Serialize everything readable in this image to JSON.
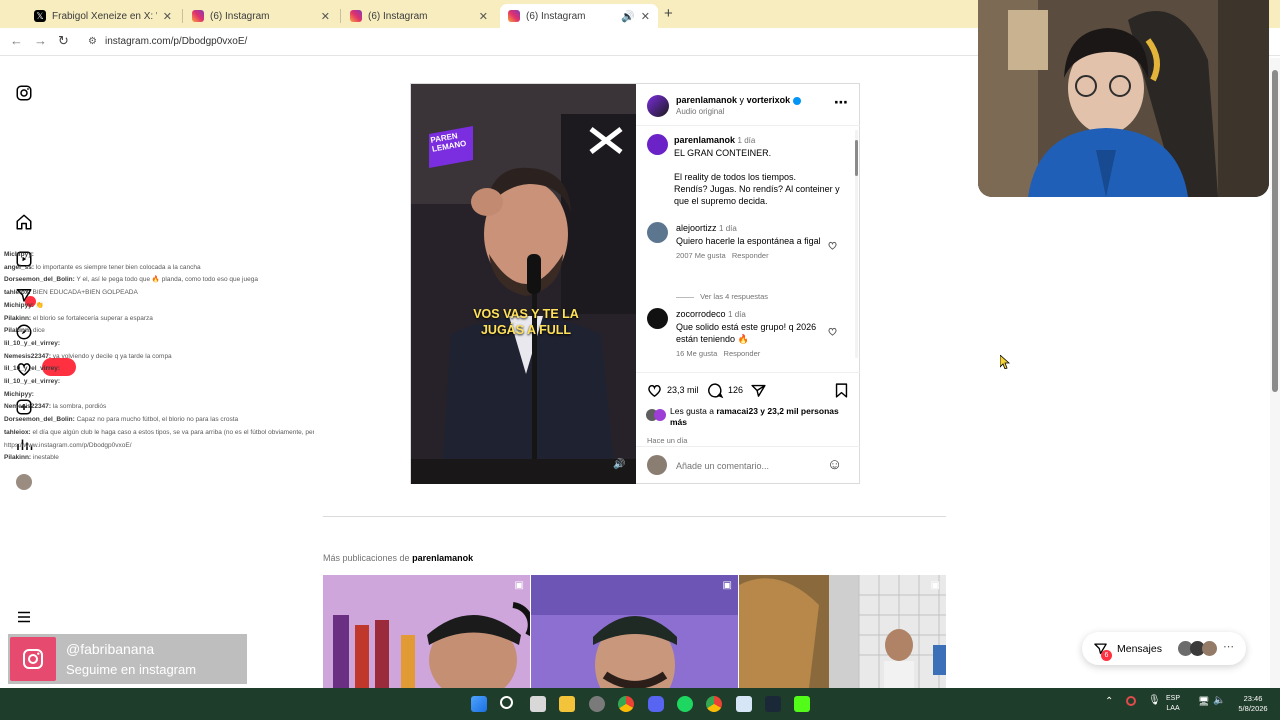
{
  "browser": {
    "tabs": [
      {
        "title": "Frabigol Xeneize en X: \"Y si jug",
        "favicon": "x-logo-icon"
      },
      {
        "title": "(6) Instagram",
        "favicon": "instagram-icon"
      },
      {
        "title": "(6) Instagram",
        "favicon": "instagram-icon"
      },
      {
        "title": "(6) Instagram",
        "favicon": "instagram-icon",
        "active": true
      }
    ],
    "new_tab": "+",
    "url": "instagram.com/p/Dbodgp0vxoE/"
  },
  "chat": [
    {
      "user": "Michipyy:",
      "msg": ""
    },
    {
      "user": "angel_ss:",
      "msg": "lo importante es siempre tener bien colocada a la cancha"
    },
    {
      "user": "Dorseemon_del_Bolin:",
      "msg": "Y el, así le pega todo que 🔥 planda, como todo eso que juega"
    },
    {
      "user": "tahleiox:",
      "msg": "BIEN EDUCADA+BIEN GOLPEADA"
    },
    {
      "user": "Michipyy:",
      "msg": "👏"
    },
    {
      "user": "Pilakinn:",
      "msg": "el blorio se fortalecería superar a esparza"
    },
    {
      "user": "Pilakinn:",
      "msg": "dice"
    },
    {
      "user": "lil_10_y_el_virrey:",
      "msg": ""
    },
    {
      "user": "Nemesis22347:",
      "msg": "ya volviendo y decile q ya tarde la compa"
    },
    {
      "user": "lil_10_y_el_virrey:",
      "msg": ""
    },
    {
      "user": "lil_10_y_el_virrey:",
      "msg": ""
    },
    {
      "user": "Michipyy:",
      "msg": ""
    },
    {
      "user": "Nemesis22347:",
      "msg": "la sombra, pordiós"
    },
    {
      "user": "Dorseemon_del_Bolin:",
      "msg": "Capaz no para mucho fútbol, el blorio no para las crosta"
    },
    {
      "user": "tahleiox:",
      "msg": "el día que algún club le haga caso a estos tipos, se va para arriba (no es el fútbol obviamente, pero en MARKETING Y VENTAS SEGURO)"
    },
    {
      "user": "",
      "msg": "https://www.instagram.com/p/Dbodgp0vxoE/"
    },
    {
      "user": "Pilakinn:",
      "msg": "inestable"
    }
  ],
  "post": {
    "header": {
      "author": "parenlamanok",
      "joiner": "y",
      "collab": "vorterixok",
      "audio": "Audio original",
      "more": "⋯"
    },
    "media": {
      "brand_top": "PAREN LEMANO",
      "caption": "VOS VAS Y TE LA JUGÁS A FULL"
    },
    "caption": {
      "user": "parenlamanok",
      "time": "1 día",
      "line1": "EL GRAN CONTEINER.",
      "line2": "El reality de todos los tiempos.",
      "line3": "Rendís? Jugas. No rendís? Al conteiner y que el supremo decida."
    },
    "comments": [
      {
        "user": "alejoortizz",
        "time": "1 día",
        "text": "Quiero hacerle la espontánea a figal",
        "likes": "2007 Me gusta",
        "reply": "Responder",
        "view_replies": "Ver las 4 respuestas"
      },
      {
        "user": "zocorrodeco",
        "time": "1 día",
        "text": "Que solido está este grupo! q 2026 están teniendo 🔥",
        "likes": "16 Me gusta",
        "reply": "Responder"
      }
    ],
    "likes_count": "23,3 mil",
    "comments_count": "126",
    "liked_by_prefix": "Les gusta a",
    "liked_by_user": "ramacai23",
    "liked_by_suffix": "y 23,2 mil personas más",
    "timestamp": "Hace un día",
    "comment_placeholder": "Añade un comentario...",
    "emoji": "☺"
  },
  "more_posts": {
    "prefix": "Más publicaciones de",
    "user": "parenlamanok"
  },
  "overlay_follow": {
    "handle": "@fabribanana",
    "subtitle": "Seguime en instagram"
  },
  "messages": {
    "label": "Mensajes",
    "badge": "6",
    "more": "⋯"
  },
  "taskbar": {
    "lang_top": "ESP",
    "lang_bottom": "LAA",
    "time": "23:46",
    "date": "5/8/2026"
  },
  "colors": {
    "tab_strip": "#f7edbf",
    "taskbar": "#1f3d2b",
    "verified": "#0095f6",
    "caption_yellow": "#ffe25a"
  }
}
